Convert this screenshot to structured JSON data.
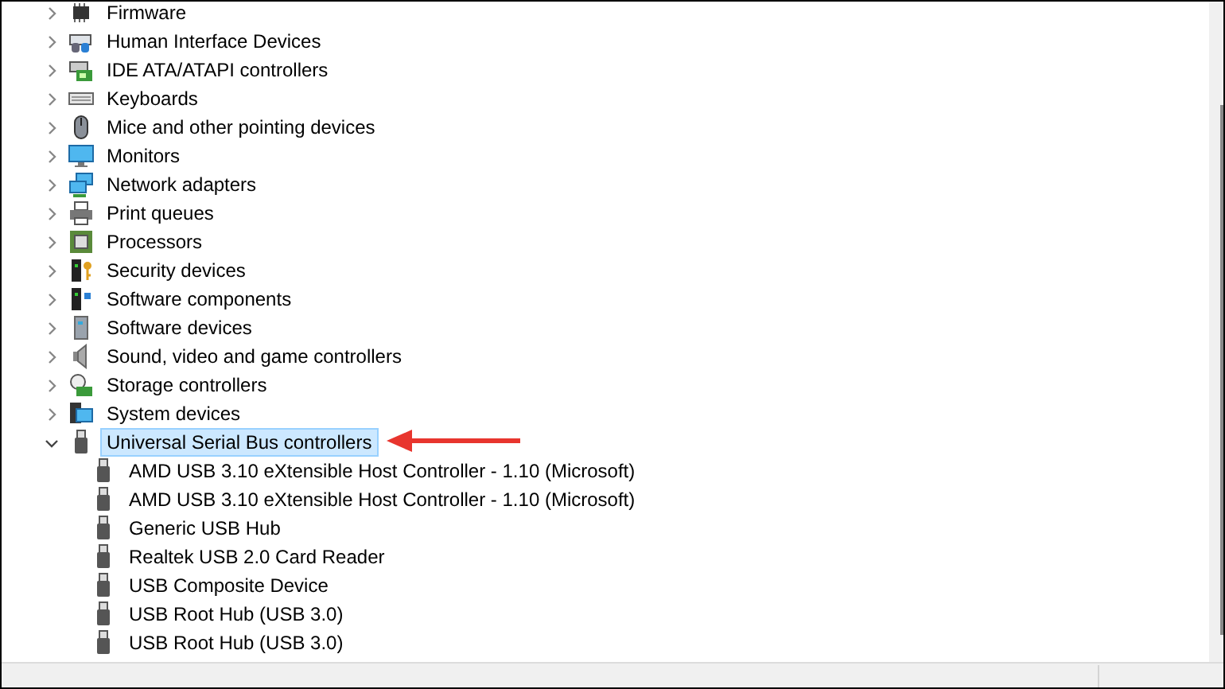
{
  "tree": [
    {
      "label": "Firmware",
      "kind": "firmware",
      "expanded": false,
      "selected": false
    },
    {
      "label": "Human Interface Devices",
      "kind": "hid",
      "expanded": false,
      "selected": false
    },
    {
      "label": "IDE ATA/ATAPI controllers",
      "kind": "ide",
      "expanded": false,
      "selected": false
    },
    {
      "label": "Keyboards",
      "kind": "keyboard",
      "expanded": false,
      "selected": false
    },
    {
      "label": "Mice and other pointing devices",
      "kind": "mouse",
      "expanded": false,
      "selected": false
    },
    {
      "label": "Monitors",
      "kind": "monitor",
      "expanded": false,
      "selected": false
    },
    {
      "label": "Network adapters",
      "kind": "network",
      "expanded": false,
      "selected": false
    },
    {
      "label": "Print queues",
      "kind": "printer",
      "expanded": false,
      "selected": false
    },
    {
      "label": "Processors",
      "kind": "processor",
      "expanded": false,
      "selected": false
    },
    {
      "label": "Security devices",
      "kind": "security",
      "expanded": false,
      "selected": false
    },
    {
      "label": "Software components",
      "kind": "component",
      "expanded": false,
      "selected": false
    },
    {
      "label": "Software devices",
      "kind": "software",
      "expanded": false,
      "selected": false
    },
    {
      "label": "Sound, video and game controllers",
      "kind": "sound",
      "expanded": false,
      "selected": false
    },
    {
      "label": "Storage controllers",
      "kind": "storage",
      "expanded": false,
      "selected": false
    },
    {
      "label": "System devices",
      "kind": "system",
      "expanded": false,
      "selected": false
    },
    {
      "label": "Universal Serial Bus controllers",
      "kind": "usb",
      "expanded": true,
      "selected": true,
      "children": [
        {
          "label": "AMD USB 3.10 eXtensible Host Controller - 1.10 (Microsoft)",
          "kind": "usb",
          "selected": false
        },
        {
          "label": "AMD USB 3.10 eXtensible Host Controller - 1.10 (Microsoft)",
          "kind": "usb",
          "selected": false
        },
        {
          "label": "Generic USB Hub",
          "kind": "usb",
          "selected": false
        },
        {
          "label": "Realtek USB 2.0 Card Reader",
          "kind": "usb",
          "selected": false
        },
        {
          "label": "USB Composite Device",
          "kind": "usb",
          "selected": false
        },
        {
          "label": "USB Root Hub (USB 3.0)",
          "kind": "usb",
          "selected": false
        },
        {
          "label": "USB Root Hub (USB 3.0)",
          "kind": "usb",
          "selected": false
        }
      ]
    }
  ]
}
